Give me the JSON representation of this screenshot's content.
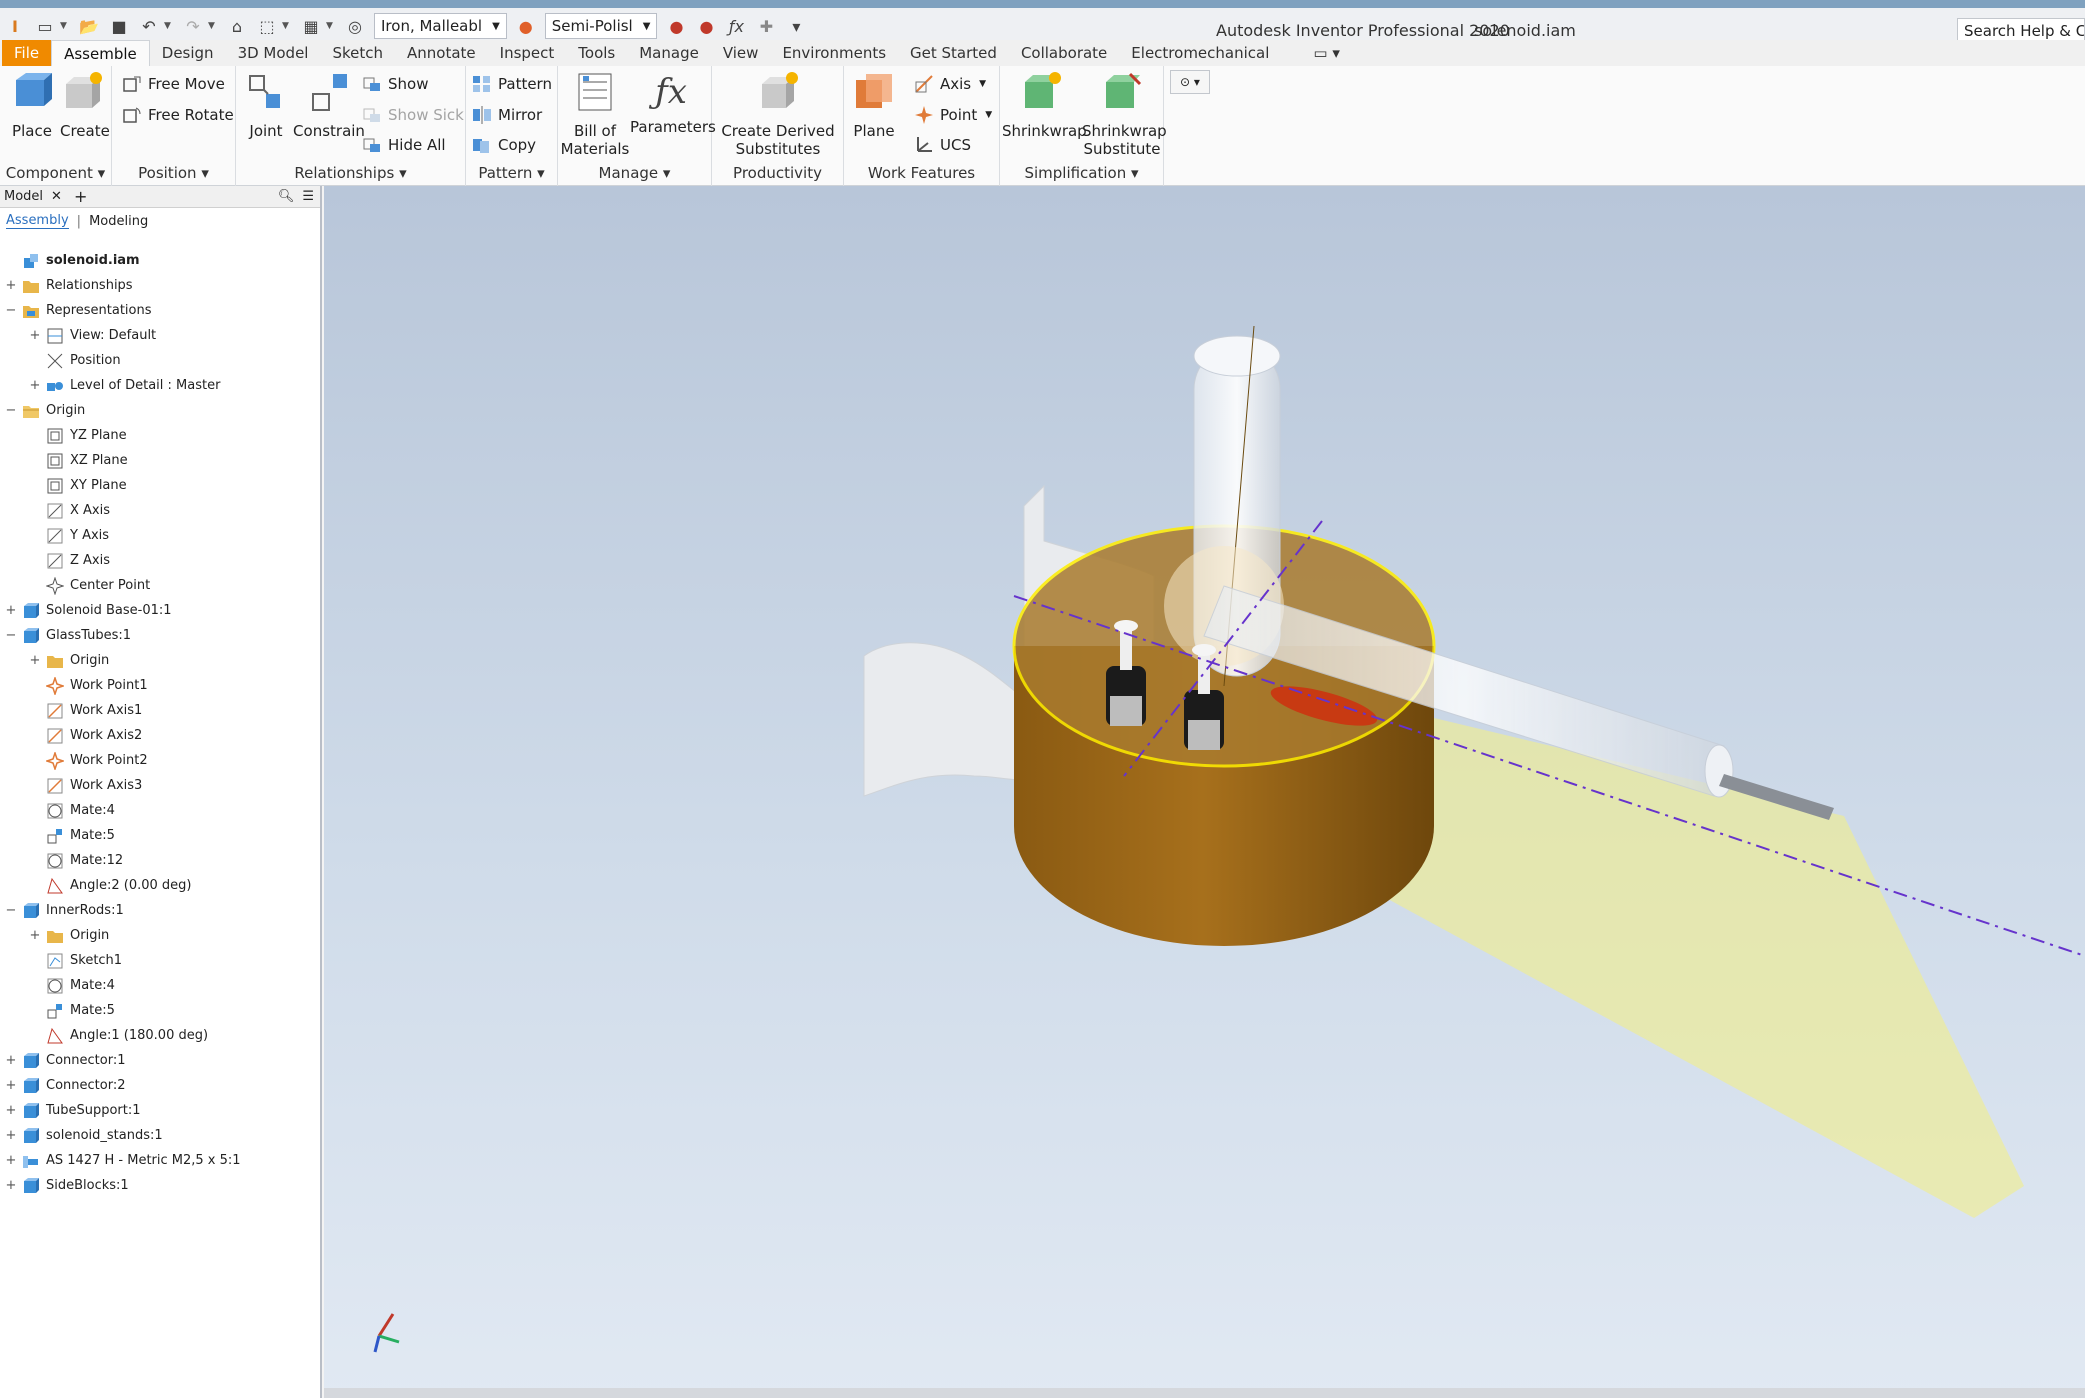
{
  "titlebar": {
    "app_title": "Autodesk Inventor Professional 2020",
    "doc_title": "solenoid.iam",
    "material": "Iron, Malleabl",
    "appearance": "Semi-Polisl",
    "search": "Search Help & Com"
  },
  "ribbon_tabs": [
    "File",
    "Assemble",
    "Design",
    "3D Model",
    "Sketch",
    "Annotate",
    "Inspect",
    "Tools",
    "Manage",
    "View",
    "Environments",
    "Get Started",
    "Collaborate",
    "Electromechanical"
  ],
  "ribbon": {
    "component": {
      "label": "Component",
      "place": "Place",
      "create": "Create"
    },
    "position": {
      "label": "Position",
      "free_move": "Free Move",
      "free_rotate": "Free Rotate"
    },
    "relationships": {
      "label": "Relationships",
      "joint": "Joint",
      "constrain": "Constrain",
      "show": "Show",
      "show_sick": "Show Sick",
      "hide_all": "Hide All"
    },
    "pattern": {
      "label": "Pattern",
      "pattern": "Pattern",
      "mirror": "Mirror",
      "copy": "Copy"
    },
    "manage": {
      "label": "Manage",
      "bom_1": "Bill of",
      "bom_2": "Materials",
      "parameters": "Parameters"
    },
    "productivity": {
      "label": "Productivity",
      "derived_1": "Create Derived",
      "derived_2": "Substitutes"
    },
    "work_features": {
      "label": "Work Features",
      "plane": "Plane",
      "axis": "Axis",
      "point": "Point",
      "ucs": "UCS"
    },
    "simplification": {
      "label": "Simplification",
      "shrinkwrap": "Shrinkwrap",
      "sub_1": "Shrinkwrap",
      "sub_2": "Substitute"
    }
  },
  "browser": {
    "tab_model": "Model",
    "sub_assembly": "Assembly",
    "sub_modeling": "Modeling",
    "items": [
      {
        "label": "solenoid.iam",
        "level": 0,
        "exp": "",
        "icon": "assembly"
      },
      {
        "label": "Relationships",
        "level": 0,
        "exp": "+",
        "icon": "folder"
      },
      {
        "label": "Representations",
        "level": 0,
        "exp": "−",
        "icon": "folder-rep"
      },
      {
        "label": "View: Default",
        "level": 1,
        "exp": "+",
        "icon": "view"
      },
      {
        "label": "Position",
        "level": 1,
        "exp": "",
        "icon": "position"
      },
      {
        "label": "Level of Detail : Master",
        "level": 1,
        "exp": "+",
        "icon": "lod"
      },
      {
        "label": "Origin",
        "level": 0,
        "exp": "−",
        "icon": "folder-open"
      },
      {
        "label": "YZ Plane",
        "level": 1,
        "exp": "",
        "icon": "plane"
      },
      {
        "label": "XZ Plane",
        "level": 1,
        "exp": "",
        "icon": "plane"
      },
      {
        "label": "XY Plane",
        "level": 1,
        "exp": "",
        "icon": "plane"
      },
      {
        "label": "X Axis",
        "level": 1,
        "exp": "",
        "icon": "axis"
      },
      {
        "label": "Y Axis",
        "level": 1,
        "exp": "",
        "icon": "axis"
      },
      {
        "label": "Z Axis",
        "level": 1,
        "exp": "",
        "icon": "axis"
      },
      {
        "label": "Center Point",
        "level": 1,
        "exp": "",
        "icon": "point"
      },
      {
        "label": "Solenoid Base-01:1",
        "level": 0,
        "exp": "+",
        "icon": "part"
      },
      {
        "label": "GlassTubes:1",
        "level": 0,
        "exp": "−",
        "icon": "part"
      },
      {
        "label": "Origin",
        "level": 1,
        "exp": "+",
        "icon": "folder"
      },
      {
        "label": "Work Point1",
        "level": 1,
        "exp": "",
        "icon": "workpoint"
      },
      {
        "label": "Work Axis1",
        "level": 1,
        "exp": "",
        "icon": "workaxis"
      },
      {
        "label": "Work Axis2",
        "level": 1,
        "exp": "",
        "icon": "workaxis"
      },
      {
        "label": "Work Point2",
        "level": 1,
        "exp": "",
        "icon": "workpoint"
      },
      {
        "label": "Work Axis3",
        "level": 1,
        "exp": "",
        "icon": "workaxis"
      },
      {
        "label": "Mate:4",
        "level": 1,
        "exp": "",
        "icon": "mate"
      },
      {
        "label": "Mate:5",
        "level": 1,
        "exp": "",
        "icon": "mate2"
      },
      {
        "label": "Mate:12",
        "level": 1,
        "exp": "",
        "icon": "mate"
      },
      {
        "label": "Angle:2 (0.00 deg)",
        "level": 1,
        "exp": "",
        "icon": "angle"
      },
      {
        "label": "InnerRods:1",
        "level": 0,
        "exp": "−",
        "icon": "part"
      },
      {
        "label": "Origin",
        "level": 1,
        "exp": "+",
        "icon": "folder"
      },
      {
        "label": "Sketch1",
        "level": 1,
        "exp": "",
        "icon": "sketch"
      },
      {
        "label": "Mate:4",
        "level": 1,
        "exp": "",
        "icon": "mate"
      },
      {
        "label": "Mate:5",
        "level": 1,
        "exp": "",
        "icon": "mate2"
      },
      {
        "label": "Angle:1 (180.00 deg)",
        "level": 1,
        "exp": "",
        "icon": "angle"
      },
      {
        "label": "Connector:1",
        "level": 0,
        "exp": "+",
        "icon": "part"
      },
      {
        "label": "Connector:2",
        "level": 0,
        "exp": "+",
        "icon": "part"
      },
      {
        "label": "TubeSupport:1",
        "level": 0,
        "exp": "+",
        "icon": "part"
      },
      {
        "label": "solenoid_stands:1",
        "level": 0,
        "exp": "+",
        "icon": "part"
      },
      {
        "label": "AS 1427 H - Metric M2,5 x 5:1",
        "level": 0,
        "exp": "+",
        "icon": "fastener"
      },
      {
        "label": "SideBlocks:1",
        "level": 0,
        "exp": "+",
        "icon": "part"
      }
    ]
  },
  "colors": {
    "accent_file": "#f08a00",
    "part_blue": "#3a8fd8",
    "folder": "#e8b64a",
    "workfeature": "#e07b39",
    "axis_line": "#6633cc"
  }
}
